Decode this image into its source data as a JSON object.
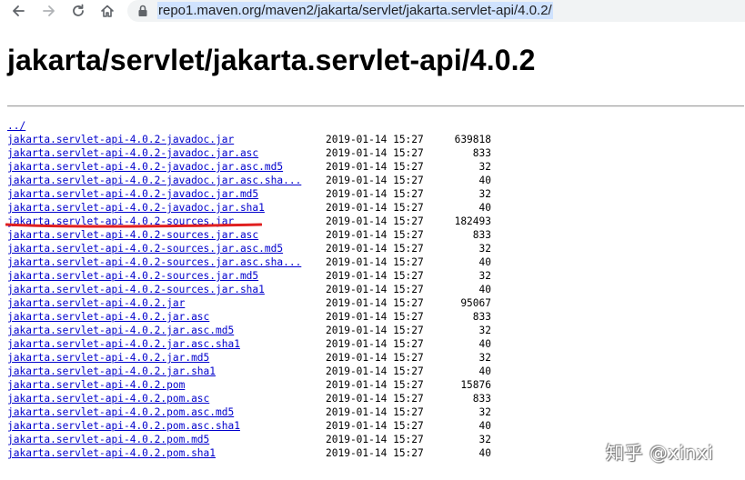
{
  "browser": {
    "url": "repo1.maven.org/maven2/jakarta/servlet/jakarta.servlet-api/4.0.2/"
  },
  "page": {
    "heading": "jakarta/servlet/jakarta.servlet-api/4.0.2",
    "parent_link": "../"
  },
  "files": [
    {
      "name": "jakarta.servlet-api-4.0.2-javadoc.jar",
      "date": "2019-01-14 15:27",
      "size": "639818"
    },
    {
      "name": "jakarta.servlet-api-4.0.2-javadoc.jar.asc",
      "date": "2019-01-14 15:27",
      "size": "833"
    },
    {
      "name": "jakarta.servlet-api-4.0.2-javadoc.jar.asc.md5",
      "date": "2019-01-14 15:27",
      "size": "32"
    },
    {
      "name": "jakarta.servlet-api-4.0.2-javadoc.jar.asc.sha...",
      "date": "2019-01-14 15:27",
      "size": "40"
    },
    {
      "name": "jakarta.servlet-api-4.0.2-javadoc.jar.md5",
      "date": "2019-01-14 15:27",
      "size": "32"
    },
    {
      "name": "jakarta.servlet-api-4.0.2-javadoc.jar.sha1",
      "date": "2019-01-14 15:27",
      "size": "40"
    },
    {
      "name": "jakarta.servlet-api-4.0.2-sources.jar",
      "date": "2019-01-14 15:27",
      "size": "182493"
    },
    {
      "name": "jakarta.servlet-api-4.0.2-sources.jar.asc",
      "date": "2019-01-14 15:27",
      "size": "833"
    },
    {
      "name": "jakarta.servlet-api-4.0.2-sources.jar.asc.md5",
      "date": "2019-01-14 15:27",
      "size": "32"
    },
    {
      "name": "jakarta.servlet-api-4.0.2-sources.jar.asc.sha...",
      "date": "2019-01-14 15:27",
      "size": "40"
    },
    {
      "name": "jakarta.servlet-api-4.0.2-sources.jar.md5",
      "date": "2019-01-14 15:27",
      "size": "32"
    },
    {
      "name": "jakarta.servlet-api-4.0.2-sources.jar.sha1",
      "date": "2019-01-14 15:27",
      "size": "40"
    },
    {
      "name": "jakarta.servlet-api-4.0.2.jar",
      "date": "2019-01-14 15:27",
      "size": "95067"
    },
    {
      "name": "jakarta.servlet-api-4.0.2.jar.asc",
      "date": "2019-01-14 15:27",
      "size": "833"
    },
    {
      "name": "jakarta.servlet-api-4.0.2.jar.asc.md5",
      "date": "2019-01-14 15:27",
      "size": "32"
    },
    {
      "name": "jakarta.servlet-api-4.0.2.jar.asc.sha1",
      "date": "2019-01-14 15:27",
      "size": "40"
    },
    {
      "name": "jakarta.servlet-api-4.0.2.jar.md5",
      "date": "2019-01-14 15:27",
      "size": "32"
    },
    {
      "name": "jakarta.servlet-api-4.0.2.jar.sha1",
      "date": "2019-01-14 15:27",
      "size": "40"
    },
    {
      "name": "jakarta.servlet-api-4.0.2.pom",
      "date": "2019-01-14 15:27",
      "size": "15876"
    },
    {
      "name": "jakarta.servlet-api-4.0.2.pom.asc",
      "date": "2019-01-14 15:27",
      "size": "833"
    },
    {
      "name": "jakarta.servlet-api-4.0.2.pom.asc.md5",
      "date": "2019-01-14 15:27",
      "size": "32"
    },
    {
      "name": "jakarta.servlet-api-4.0.2.pom.asc.sha1",
      "date": "2019-01-14 15:27",
      "size": "40"
    },
    {
      "name": "jakarta.servlet-api-4.0.2.pom.md5",
      "date": "2019-01-14 15:27",
      "size": "32"
    },
    {
      "name": "jakarta.servlet-api-4.0.2.pom.sha1",
      "date": "2019-01-14 15:27",
      "size": "40"
    }
  ],
  "watermark": "知乎 @xinxi",
  "colors": {
    "link": "#0000cc",
    "annotation": "#e02020",
    "url_highlight": "#cfe2fe"
  }
}
